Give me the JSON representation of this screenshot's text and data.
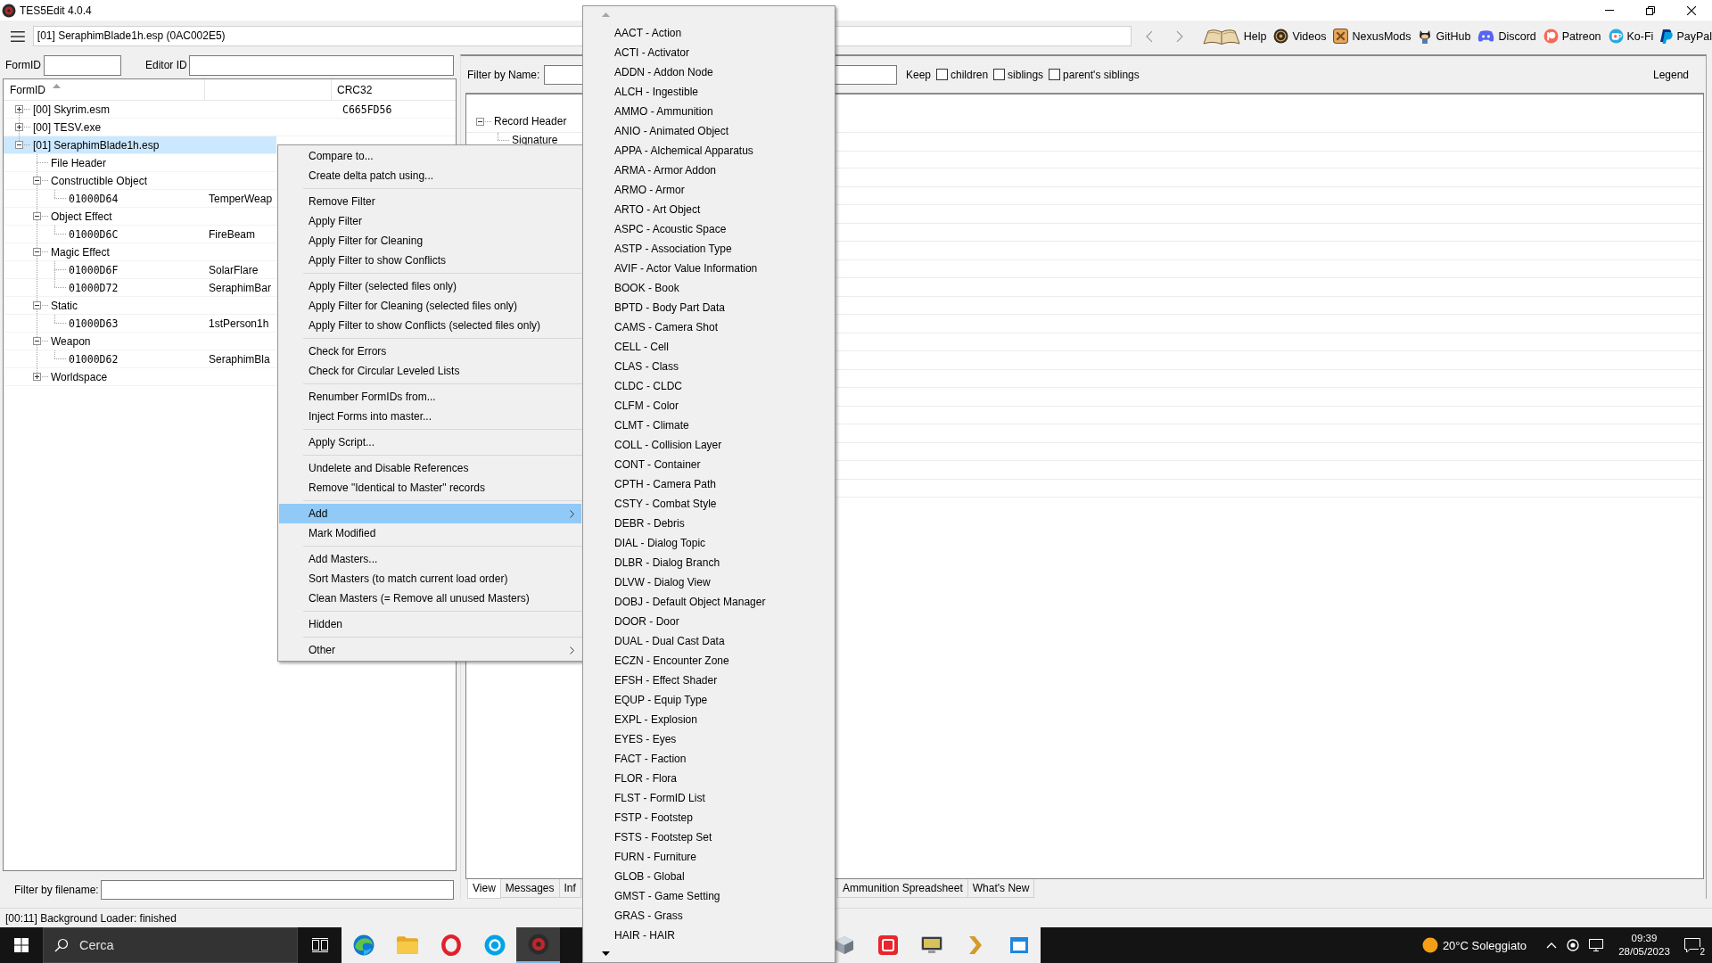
{
  "window": {
    "title": "TES5Edit 4.0.4"
  },
  "toolbar": {
    "path": "[01] SeraphimBlade1h.esp (0AC002E5)",
    "back": {
      "disabled": true
    },
    "forward": {
      "disabled": true
    },
    "links": [
      {
        "label": "Help"
      },
      {
        "label": "Videos"
      },
      {
        "label": "NexusMods"
      },
      {
        "label": "GitHub"
      },
      {
        "label": "Discord"
      },
      {
        "label": "Patreon"
      },
      {
        "label": "Ko-Fi"
      },
      {
        "label": "PayPal"
      }
    ]
  },
  "id_filters": {
    "formid_label": "FormID",
    "editorid_label": "Editor ID"
  },
  "tree": {
    "header": {
      "formid": "FormID",
      "crc32": "CRC32",
      "sort_ascending": true
    },
    "nodes": [
      {
        "kind": "entry",
        "label": "[00] Skyrim.esm",
        "crc32": "C665FD56",
        "expanded": false,
        "selected": false
      },
      {
        "kind": "entry",
        "label": "[00] TESV.exe",
        "expanded": false,
        "selected": false
      },
      {
        "kind": "entry",
        "label": "[01] SeraphimBlade1h.esp",
        "expanded": true,
        "selected": true,
        "children": [
          {
            "kind": "entry",
            "label": "File Header",
            "selected": false
          },
          {
            "kind": "entry",
            "label": "Constructible Object",
            "expanded": true,
            "selected": false,
            "children": [
              {
                "kind": "record",
                "label": "01000D64",
                "editor_id": "TemperWeap",
                "selected": false
              }
            ]
          },
          {
            "kind": "entry",
            "label": "Object Effect",
            "expanded": true,
            "selected": false,
            "children": [
              {
                "kind": "record",
                "label": "01000D6C",
                "editor_id": "FireBeam",
                "selected": false
              }
            ]
          },
          {
            "kind": "entry",
            "label": "Magic Effect",
            "expanded": true,
            "selected": false,
            "children": [
              {
                "kind": "record",
                "label": "01000D6F",
                "editor_id": "SolarFlare",
                "selected": false
              },
              {
                "kind": "record",
                "label": "01000D72",
                "editor_id": "SeraphimBar",
                "selected": false
              }
            ]
          },
          {
            "kind": "entry",
            "label": "Static",
            "expanded": true,
            "selected": false,
            "children": [
              {
                "kind": "record",
                "label": "01000D63",
                "editor_id": "1stPerson1h",
                "selected": false
              }
            ]
          },
          {
            "kind": "entry",
            "label": "Weapon",
            "expanded": true,
            "selected": false,
            "children": [
              {
                "kind": "record",
                "label": "01000D62",
                "editor_id": "SeraphimBla",
                "selected": false
              }
            ]
          },
          {
            "kind": "entry",
            "label": "Worldspace",
            "expanded": false,
            "selected": false
          }
        ]
      }
    ]
  },
  "file_filter": {
    "label": "Filter by filename:"
  },
  "record_filter": {
    "label": "Filter by Name:",
    "keep_label": "Keep",
    "options": [
      {
        "label": "children",
        "checked": false
      },
      {
        "label": "siblings",
        "checked": false
      },
      {
        "label": "parent's siblings",
        "checked": false
      }
    ],
    "legend": "Legend"
  },
  "record_view": {
    "nodes": [
      {
        "label": "Record Header",
        "expanded": true,
        "selected": false,
        "children": [
          {
            "label": "Signature",
            "selected": false
          }
        ]
      }
    ]
  },
  "view_tabs": [
    {
      "label": "View",
      "selected": true
    },
    {
      "label": "Messages",
      "selected": false
    },
    {
      "label": "Inf",
      "selected": false
    },
    {
      "label": "Ammunition Spreadsheet",
      "selected": false
    },
    {
      "label": "What's New",
      "selected": false
    }
  ],
  "status_bar": {
    "text": "[00:11] Background Loader: finished"
  },
  "context_menu": {
    "groups": [
      [
        {
          "label": "Compare to...",
          "selected": false,
          "submenu": false
        },
        {
          "label": "Create delta patch using...",
          "selected": false,
          "submenu": false
        }
      ],
      [
        {
          "label": "Remove Filter",
          "selected": false,
          "submenu": false
        },
        {
          "label": "Apply Filter",
          "selected": false,
          "submenu": false
        },
        {
          "label": "Apply Filter for Cleaning",
          "selected": false,
          "submenu": false
        },
        {
          "label": "Apply Filter to show Conflicts",
          "selected": false,
          "submenu": false
        }
      ],
      [
        {
          "label": "Apply Filter (selected files only)",
          "selected": false,
          "submenu": false
        },
        {
          "label": "Apply Filter for Cleaning (selected files only)",
          "selected": false,
          "submenu": false
        },
        {
          "label": "Apply Filter to show Conflicts (selected files only)",
          "selected": false,
          "submenu": false
        }
      ],
      [
        {
          "label": "Check for Errors",
          "selected": false,
          "submenu": false
        },
        {
          "label": "Check for Circular Leveled Lists",
          "selected": false,
          "submenu": false
        }
      ],
      [
        {
          "label": "Renumber FormIDs from...",
          "selected": false,
          "submenu": false
        },
        {
          "label": "Inject Forms into master...",
          "selected": false,
          "submenu": false
        }
      ],
      [
        {
          "label": "Apply Script...",
          "selected": false,
          "submenu": false
        }
      ],
      [
        {
          "label": "Undelete and Disable References",
          "selected": false,
          "submenu": false
        },
        {
          "label": "Remove \"Identical to Master\" records",
          "selected": false,
          "submenu": false
        }
      ],
      [
        {
          "label": "Add",
          "selected": true,
          "submenu": true
        },
        {
          "label": "Mark Modified",
          "selected": false,
          "submenu": false
        }
      ],
      [
        {
          "label": "Add Masters...",
          "selected": false,
          "submenu": false
        },
        {
          "label": "Sort Masters (to match current load order)",
          "selected": false,
          "submenu": false
        },
        {
          "label": "Clean Masters (= Remove all unused Masters)",
          "selected": false,
          "submenu": false
        }
      ],
      [
        {
          "label": "Hidden",
          "selected": false,
          "submenu": false
        }
      ],
      [
        {
          "label": "Other",
          "selected": false,
          "submenu": true
        }
      ]
    ]
  },
  "add_submenu": {
    "items": [
      {
        "label": "AACT - Action",
        "selected": false
      },
      {
        "label": "ACTI - Activator",
        "selected": false
      },
      {
        "label": "ADDN - Addon Node",
        "selected": false
      },
      {
        "label": "ALCH - Ingestible",
        "selected": false
      },
      {
        "label": "AMMO - Ammunition",
        "selected": false
      },
      {
        "label": "ANIO - Animated Object",
        "selected": false
      },
      {
        "label": "APPA - Alchemical Apparatus",
        "selected": false
      },
      {
        "label": "ARMA - Armor Addon",
        "selected": false
      },
      {
        "label": "ARMO - Armor",
        "selected": false
      },
      {
        "label": "ARTO - Art Object",
        "selected": false
      },
      {
        "label": "ASPC - Acoustic Space",
        "selected": false
      },
      {
        "label": "ASTP - Association Type",
        "selected": false
      },
      {
        "label": "AVIF - Actor Value Information",
        "selected": false
      },
      {
        "label": "BOOK - Book",
        "selected": false
      },
      {
        "label": "BPTD - Body Part Data",
        "selected": false
      },
      {
        "label": "CAMS - Camera Shot",
        "selected": false
      },
      {
        "label": "CELL - Cell",
        "selected": false
      },
      {
        "label": "CLAS - Class",
        "selected": false
      },
      {
        "label": "CLDC - CLDC",
        "selected": false
      },
      {
        "label": "CLFM - Color",
        "selected": false
      },
      {
        "label": "CLMT - Climate",
        "selected": false
      },
      {
        "label": "COLL - Collision Layer",
        "selected": false
      },
      {
        "label": "CONT - Container",
        "selected": false
      },
      {
        "label": "CPTH - Camera Path",
        "selected": false
      },
      {
        "label": "CSTY - Combat Style",
        "selected": false
      },
      {
        "label": "DEBR - Debris",
        "selected": false
      },
      {
        "label": "DIAL - Dialog Topic",
        "selected": false
      },
      {
        "label": "DLBR - Dialog Branch",
        "selected": false
      },
      {
        "label": "DLVW - Dialog View",
        "selected": false
      },
      {
        "label": "DOBJ - Default Object Manager",
        "selected": false
      },
      {
        "label": "DOOR - Door",
        "selected": false
      },
      {
        "label": "DUAL - Dual Cast Data",
        "selected": false
      },
      {
        "label": "ECZN - Encounter Zone",
        "selected": false
      },
      {
        "label": "EFSH - Effect Shader",
        "selected": false
      },
      {
        "label": "EQUP - Equip Type",
        "selected": false
      },
      {
        "label": "EXPL - Explosion",
        "selected": false
      },
      {
        "label": "EYES - Eyes",
        "selected": false
      },
      {
        "label": "FACT - Faction",
        "selected": false
      },
      {
        "label": "FLOR - Flora",
        "selected": false
      },
      {
        "label": "FLST - FormID List",
        "selected": false
      },
      {
        "label": "FSTP - Footstep",
        "selected": false
      },
      {
        "label": "FSTS - Footstep Set",
        "selected": false
      },
      {
        "label": "FURN - Furniture",
        "selected": false
      },
      {
        "label": "GLOB - Global",
        "selected": false
      },
      {
        "label": "GMST - Game Setting",
        "selected": false
      },
      {
        "label": "GRAS - Grass",
        "selected": false
      },
      {
        "label": "HAIR - HAIR",
        "selected": false
      }
    ]
  },
  "taskbar": {
    "search": {
      "placeholder": "Cerca"
    },
    "apps": [
      {
        "selected": false
      },
      {
        "selected": false
      },
      {
        "selected": false
      },
      {
        "selected": false
      },
      {
        "selected": true
      },
      {
        "selected": false
      },
      {
        "selected": false
      },
      {
        "selected": false
      },
      {
        "selected": false
      },
      {
        "selected": false
      }
    ],
    "weather": "20°C Soleggiato",
    "time": "09:39",
    "date": "28/05/2023",
    "notifications": "2"
  }
}
